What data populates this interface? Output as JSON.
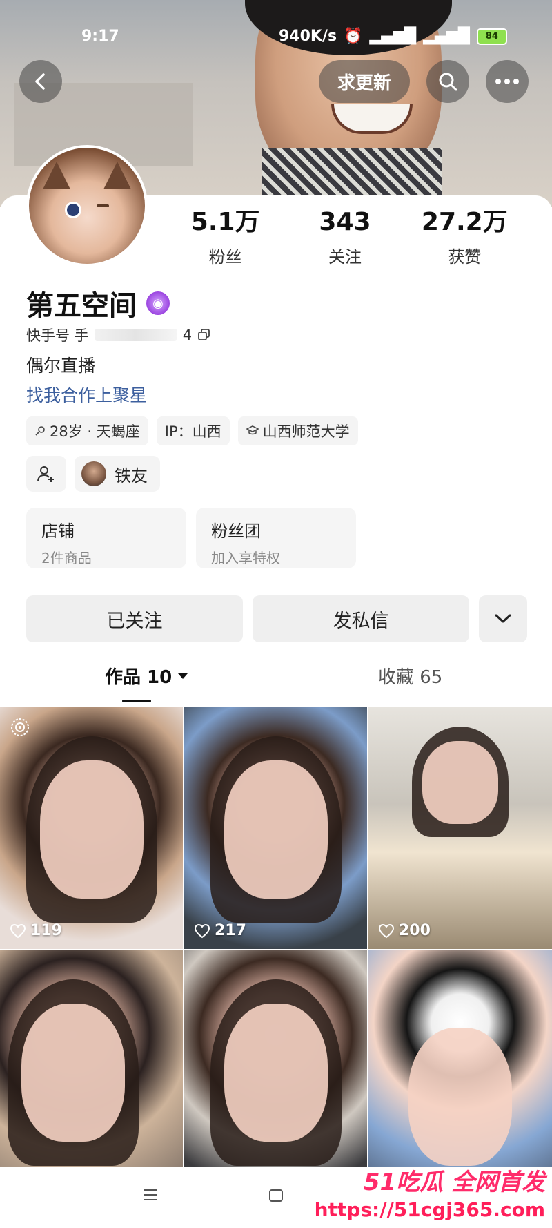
{
  "status_bar": {
    "time": "9:17",
    "network_speed": "940K/s",
    "battery": "84"
  },
  "header": {
    "update_button": "求更新"
  },
  "profile": {
    "stats": [
      {
        "value": "5.1万",
        "label": "粉丝"
      },
      {
        "value": "343",
        "label": "关注"
      },
      {
        "value": "27.2万",
        "label": "获赞"
      }
    ],
    "name": "第五空间",
    "id_prefix": "快手号 手",
    "id_suffix": "4",
    "bio": "偶尔直播",
    "coop_link": "找我合作上聚星",
    "tags": [
      "28岁 · 天蝎座",
      "IP：山西",
      "山西师范大学"
    ],
    "fan_club_name": "铁友"
  },
  "info_cards": [
    {
      "title": "店铺",
      "sub": "2件商品"
    },
    {
      "title": "粉丝团",
      "sub": "加入享特权"
    }
  ],
  "actions": {
    "follow": "已关注",
    "message": "发私信"
  },
  "tabs": {
    "works": "作品 10",
    "favorites": "收藏 65"
  },
  "videos": [
    {
      "likes": "119"
    },
    {
      "likes": "217"
    },
    {
      "likes": "200"
    },
    {
      "likes": ""
    },
    {
      "likes": ""
    },
    {
      "likes": ""
    }
  ],
  "watermark": {
    "slogan": "51吃瓜 全网首发",
    "url": "https://51cgj365.com"
  },
  "colors": {
    "link": "#3c5f9e",
    "badge": "#9b45e0",
    "watermark": "#ff1f5a"
  }
}
